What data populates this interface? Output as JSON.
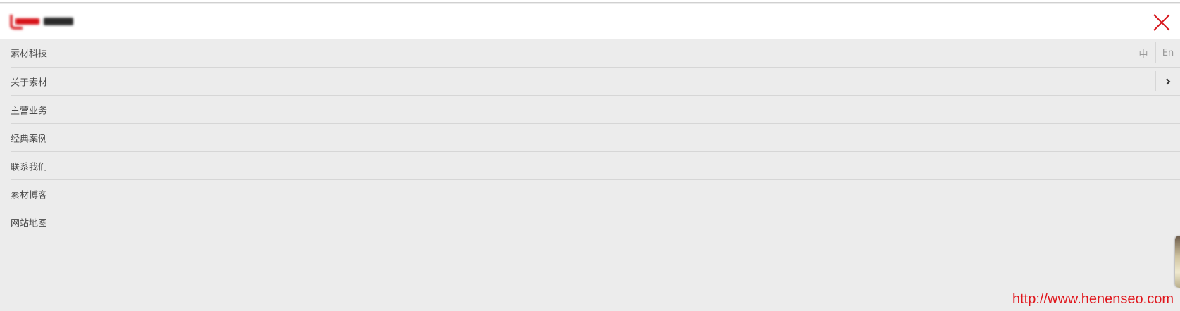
{
  "header": {
    "logo_text": "SHA Web",
    "close_icon": "close-icon"
  },
  "menu": {
    "items": [
      {
        "label": "素材科技"
      },
      {
        "label": "关于素材"
      },
      {
        "label": "主营业务"
      },
      {
        "label": "经典案例"
      },
      {
        "label": "联系我们"
      },
      {
        "label": "素材博客"
      },
      {
        "label": "网站地图"
      }
    ],
    "lang": {
      "zh_label": "中",
      "en_label": "En"
    },
    "expand_icon": "chevron-right-icon"
  },
  "watermark": {
    "text": "http://www.henenseo.com"
  },
  "colors": {
    "accent": "#d7141a",
    "menu_background": "#ececec",
    "header_background": "#ffffff",
    "divider": "#d6d6d6",
    "watermark": "#e0161c"
  }
}
